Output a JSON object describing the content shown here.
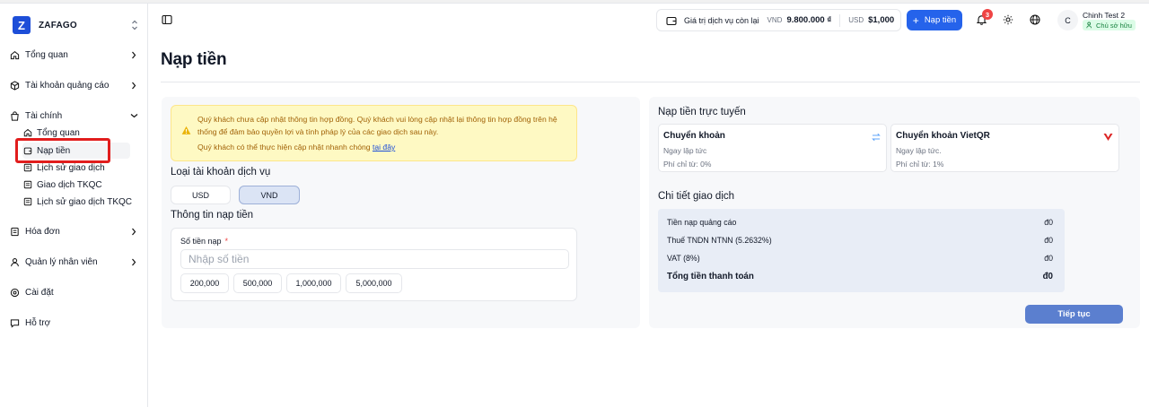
{
  "brand": {
    "name": "ZAFAGO",
    "logo_letter": "Z"
  },
  "sidebar": {
    "items": [
      {
        "label": "Tổng quan",
        "icon": "home-icon"
      },
      {
        "label": "Tài khoản quảng cáo",
        "icon": "box-icon"
      },
      {
        "label": "Tài chính",
        "icon": "bag-icon",
        "expanded": true
      },
      {
        "label": "Hóa đơn",
        "icon": "receipt-icon"
      },
      {
        "label": "Quản lý nhân viên",
        "icon": "user-icon"
      },
      {
        "label": "Cài đặt",
        "icon": "settings-icon"
      },
      {
        "label": "Hỗ trợ",
        "icon": "chat-icon"
      }
    ],
    "finance_sub": [
      {
        "label": "Tổng quan",
        "icon": "home-icon"
      },
      {
        "label": "Nạp tiền",
        "icon": "wallet-icon",
        "active": true
      },
      {
        "label": "Lịch sử giao dịch",
        "icon": "history-icon"
      },
      {
        "label": "Giao dịch TKQC",
        "icon": "history-icon"
      },
      {
        "label": "Lịch sử giao dịch TKQC",
        "icon": "history-icon"
      }
    ]
  },
  "header": {
    "balance_label": "Giá trị dịch vụ còn lại",
    "vnd_currency": "VND",
    "vnd_amount": "9.800.000 ₫",
    "usd_currency": "USD",
    "usd_amount": "$1,000",
    "topup_button": "Nạp tiền",
    "notification_count": "3",
    "avatar_letter": "C",
    "user_name": "Chinh Test 2",
    "user_role": "Chủ sở hữu"
  },
  "page": {
    "title": "Nạp tiền"
  },
  "alert": {
    "message": "Quý khách chưa cập nhật thông tin hợp đồng. Quý khách vui lòng cập nhật lại thông tin hợp đồng trên hệ thống để đảm bảo quyền lợi và tính pháp lý của các giao dịch sau này.",
    "quick_text": "Quý khách có thể thực hiện cập nhật nhanh chóng",
    "link_text": "tại đây"
  },
  "account_type": {
    "title": "Loại tài khoản dịch vụ",
    "options": [
      "USD",
      "VND"
    ],
    "selected": "VND"
  },
  "topup_info": {
    "title": "Thông tin nạp tiền",
    "amount_label": "Số tiền nạp",
    "required_mark": "*",
    "amount_placeholder": "Nhập số tiền",
    "presets": [
      "200,000",
      "500,000",
      "1,000,000",
      "5,000,000"
    ]
  },
  "online_topup": {
    "title": "Nạp tiền trực tuyến",
    "methods": [
      {
        "name": "Chuyển khoản",
        "speed": "Ngay lập tức",
        "fee": "Phí chỉ từ: 0%",
        "icon": "swap-icon"
      },
      {
        "name": "Chuyển khoản VietQR",
        "speed": "Ngay lập tức.",
        "fee": "Phí chỉ từ: 1%",
        "icon": "vietqr-logo-icon"
      }
    ]
  },
  "transaction_details": {
    "title": "Chi tiết giao dịch",
    "rows": [
      {
        "label": "Tiền nạp quảng cáo",
        "value": "đ0"
      },
      {
        "label": "Thuế TNDN NTNN (5.2632%)",
        "value": "đ0"
      },
      {
        "label": "VAT (8%)",
        "value": "đ0"
      },
      {
        "label": "Tổng tiền thanh toán",
        "value": "đ0"
      }
    ],
    "continue_button": "Tiếp tục"
  },
  "colors": {
    "primary": "#2563eb",
    "highlight": "#e11d1d",
    "warning_text": "#a16207",
    "success": "#15803d"
  }
}
